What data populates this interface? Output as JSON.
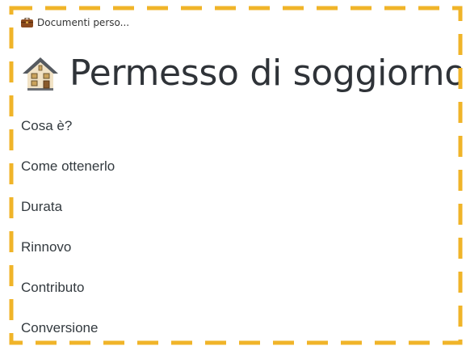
{
  "breadcrumb": {
    "icon": "briefcase-icon",
    "label": "Documenti perso..."
  },
  "page": {
    "icon": "house-icon",
    "title": "Permesso di soggiorno"
  },
  "menu": {
    "items": [
      {
        "label": "Cosa è?"
      },
      {
        "label": "Come ottenerlo"
      },
      {
        "label": "Durata"
      },
      {
        "label": "Rinnovo"
      },
      {
        "label": "Contributo"
      },
      {
        "label": "Conversione"
      }
    ]
  },
  "colors": {
    "dash_border": "#f0b429",
    "title_text": "#2f3338",
    "item_text": "#333a3f"
  }
}
